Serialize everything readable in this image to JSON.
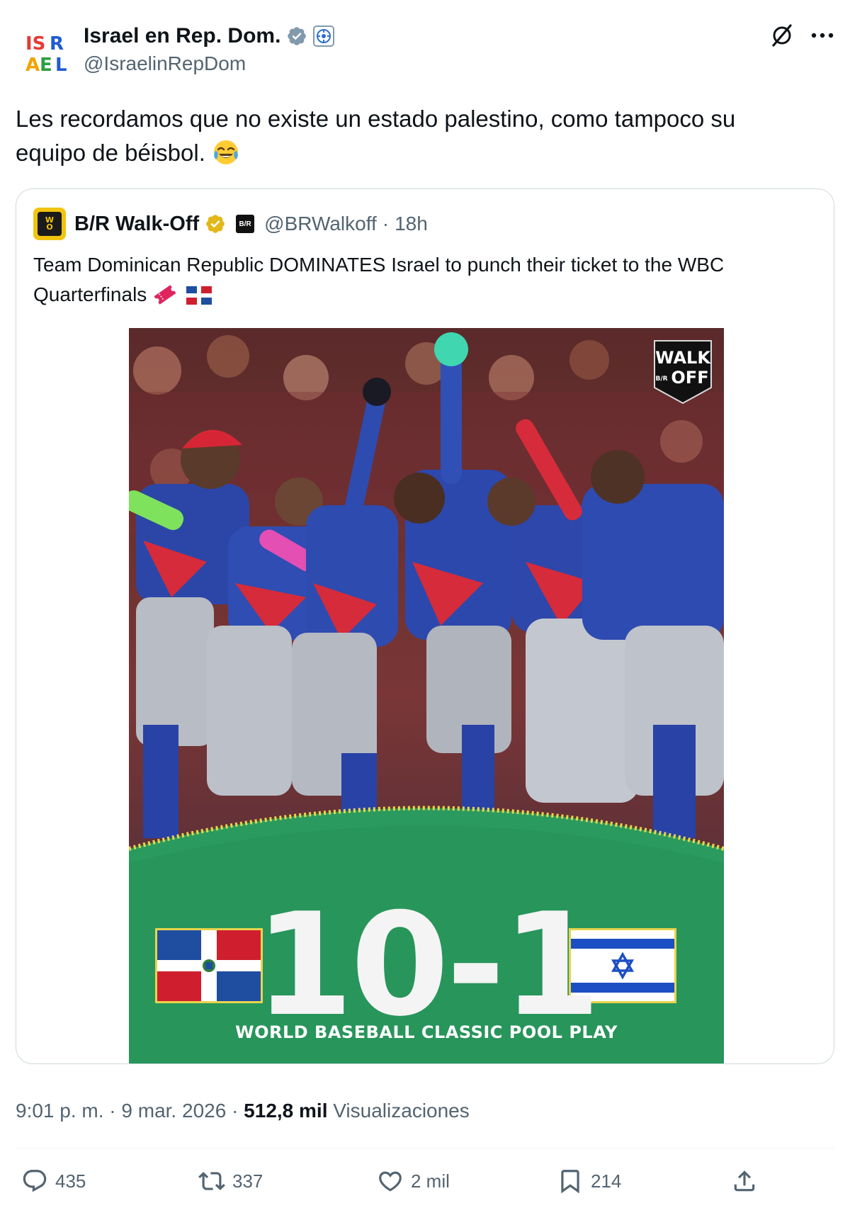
{
  "post": {
    "author": {
      "display_name": "Israel en Rep. Dom.",
      "handle": "@IsraelinRepDom",
      "avatar_icon": "israel-logo-avatar",
      "verified_color": "#829aab"
    },
    "text": "Les recordamos que no existe un estado palestino, como tampoco su equipo de béisbol.",
    "emoji": "face-with-tears-of-joy"
  },
  "quote": {
    "author": {
      "display_name": "B/R Walk-Off",
      "handle": "@BRWalkoff",
      "separator": "·",
      "time": "18h",
      "verified_color": "#e2b719",
      "affiliate_icon": "br-affiliate-badge"
    },
    "text": "Team Dominican Republic DOMINATES Israel to punch their ticket to the WBC Quarterfinals",
    "emojis": [
      "ticket",
      "flag-dominican-republic"
    ],
    "image": {
      "description_icon": "team-celebration-photo",
      "logo_text_top": "WALK",
      "logo_text_bottom": "OFF",
      "logo_badge": "B/R",
      "score": "10-1",
      "caption": "WORLD BASEBALL CLASSIC POOL PLAY",
      "left_flag": "flag-dominican-republic",
      "right_flag": "flag-israel"
    }
  },
  "meta": {
    "time": "9:01 p. m.",
    "sep1": "·",
    "date": "9 mar. 2026",
    "sep2": "·",
    "views": "512,8 mil",
    "views_label": "Visualizaciones"
  },
  "actions": {
    "replies": "435",
    "reposts": "337",
    "likes": "2 mil",
    "bookmarks": "214"
  },
  "colors": {
    "text_primary": "#0f1419",
    "text_secondary": "#536471",
    "border": "#cfd9de",
    "score_green": "#27935a"
  }
}
